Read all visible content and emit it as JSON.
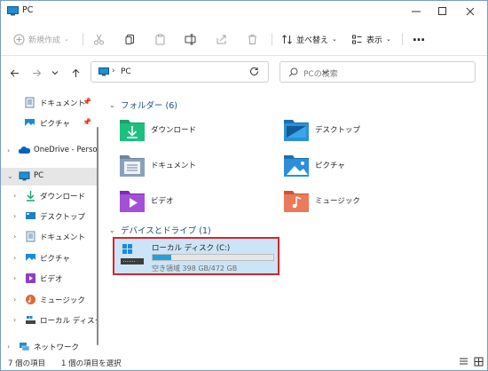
{
  "window": {
    "title": "PC",
    "minimize_icon": "minimize-icon",
    "maximize_icon": "maximize-icon",
    "close_icon": "close-icon"
  },
  "toolbar": {
    "new_label": "新規作成",
    "sort_label": "並べ替え",
    "view_label": "表示",
    "more_label": "…",
    "icons": [
      "new-icon",
      "cut-icon",
      "copy-icon",
      "paste-icon",
      "rename-icon",
      "share-icon",
      "delete-icon",
      "sort-icon",
      "view-icon",
      "more-icon"
    ]
  },
  "address": {
    "path": "PC",
    "search_placeholder": "PCの検索"
  },
  "sidebar": {
    "items": [
      {
        "label": "ドキュメント",
        "icon": "documents-icon",
        "pinned": true
      },
      {
        "label": "ピクチャ",
        "icon": "pictures-icon",
        "pinned": true
      },
      {
        "label": "OneDrive - Perso",
        "icon": "onedrive-icon"
      },
      {
        "label": "PC",
        "icon": "pc-icon",
        "selected": true
      },
      {
        "label": "ダウンロード",
        "icon": "downloads-icon"
      },
      {
        "label": "デスクトップ",
        "icon": "desktop-icon"
      },
      {
        "label": "ドキュメント",
        "icon": "documents-icon"
      },
      {
        "label": "ピクチャ",
        "icon": "pictures-icon"
      },
      {
        "label": "ビデオ",
        "icon": "videos-icon"
      },
      {
        "label": "ミュージック",
        "icon": "music-icon"
      },
      {
        "label": "ローカル ディスク (",
        "icon": "drive-icon"
      },
      {
        "label": "ネットワーク",
        "icon": "network-icon"
      }
    ]
  },
  "main": {
    "folders_header": "フォルダー (6)",
    "folders": [
      {
        "label": "ダウンロード",
        "icon": "downloads-folder-icon"
      },
      {
        "label": "デスクトップ",
        "icon": "desktop-folder-icon"
      },
      {
        "label": "ドキュメント",
        "icon": "documents-folder-icon"
      },
      {
        "label": "ピクチャ",
        "icon": "pictures-folder-icon"
      },
      {
        "label": "ビデオ",
        "icon": "videos-folder-icon"
      },
      {
        "label": "ミュージック",
        "icon": "music-folder-icon"
      }
    ],
    "drives_header": "デバイスとドライブ (1)",
    "drive": {
      "name": "ローカル ディスク (C:)",
      "space": "空き領域 398 GB/472 GB",
      "used_fraction": 0.157
    }
  },
  "statusbar": {
    "count": "7 個の項目",
    "selected": "1 個の項目を選択"
  },
  "colors": {
    "accent": "#26a0da",
    "selection": "#cce4f7",
    "highlight_border": "#d6262c",
    "section_header": "#1a4f8a"
  }
}
